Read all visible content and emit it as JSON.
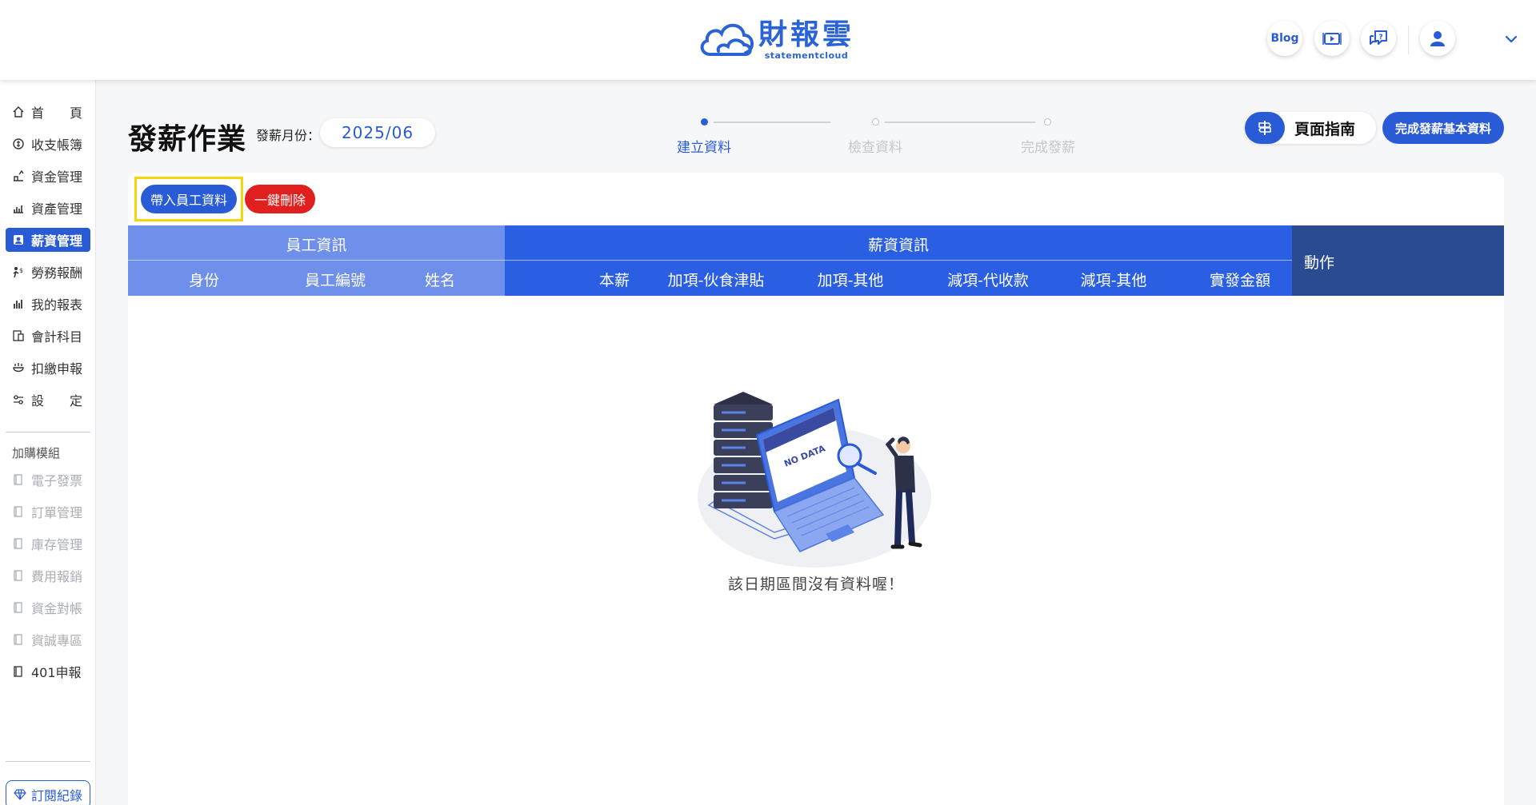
{
  "header": {
    "logo_cn": "財報雲",
    "logo_en": "statementcloud",
    "blog_label": "Blog"
  },
  "sidebar": {
    "items": [
      {
        "label": "首　　頁",
        "icon": "home-icon",
        "state": "normal"
      },
      {
        "label": "收支帳簿",
        "icon": "ledger-icon",
        "state": "normal"
      },
      {
        "label": "資金管理",
        "icon": "fund-icon",
        "state": "normal"
      },
      {
        "label": "資產管理",
        "icon": "asset-icon",
        "state": "normal"
      },
      {
        "label": "薪資管理",
        "icon": "payroll-icon",
        "state": "active"
      },
      {
        "label": "勞務報酬",
        "icon": "labor-icon",
        "state": "normal"
      },
      {
        "label": "我的報表",
        "icon": "report-icon",
        "state": "normal"
      },
      {
        "label": "會計科目",
        "icon": "account-icon",
        "state": "normal"
      },
      {
        "label": "扣繳申報",
        "icon": "withholding-icon",
        "state": "normal"
      },
      {
        "label": "設　　定",
        "icon": "settings-icon",
        "state": "normal"
      }
    ],
    "addon_heading": "加購模組",
    "addons": [
      {
        "label": "電子發票",
        "state": "disabled"
      },
      {
        "label": "訂單管理",
        "state": "disabled"
      },
      {
        "label": "庫存管理",
        "state": "disabled"
      },
      {
        "label": "費用報銷",
        "state": "disabled"
      },
      {
        "label": "資金對帳",
        "state": "disabled"
      },
      {
        "label": "資誠專區",
        "state": "disabled"
      },
      {
        "label": "401申報",
        "state": "normal"
      }
    ],
    "subscription_label": "訂閱紀錄"
  },
  "page": {
    "title": "發薪作業",
    "month_label": "發薪月份：",
    "month_value": "2025/06",
    "steps": [
      {
        "label": "建立資料",
        "active": true
      },
      {
        "label": "檢查資料",
        "active": false
      },
      {
        "label": "完成發薪",
        "active": false
      }
    ],
    "guide_label": "頁面指南",
    "done_label": "完成發薪基本資料",
    "import_label": "帶入員工資料",
    "delete_label": "一鍵刪除"
  },
  "table": {
    "group_employee": "員工資訊",
    "group_salary": "薪資資訊",
    "action": "動作",
    "columns": [
      "身份",
      "員工編號",
      "姓名",
      "本薪",
      "加項-伙食津貼",
      "加項-其他",
      "減項-代收款",
      "減項-其他",
      "實發金額"
    ]
  },
  "empty": {
    "illustration_text": "NO DATA",
    "message": "該日期區間沒有資料喔！"
  },
  "colors": {
    "primary": "#2a5bd7",
    "danger": "#e0201e",
    "employee_header": "#6e8fea",
    "salary_header": "#2a5ee3",
    "action_header": "#2a4a92",
    "highlight": "#f5d60c"
  }
}
